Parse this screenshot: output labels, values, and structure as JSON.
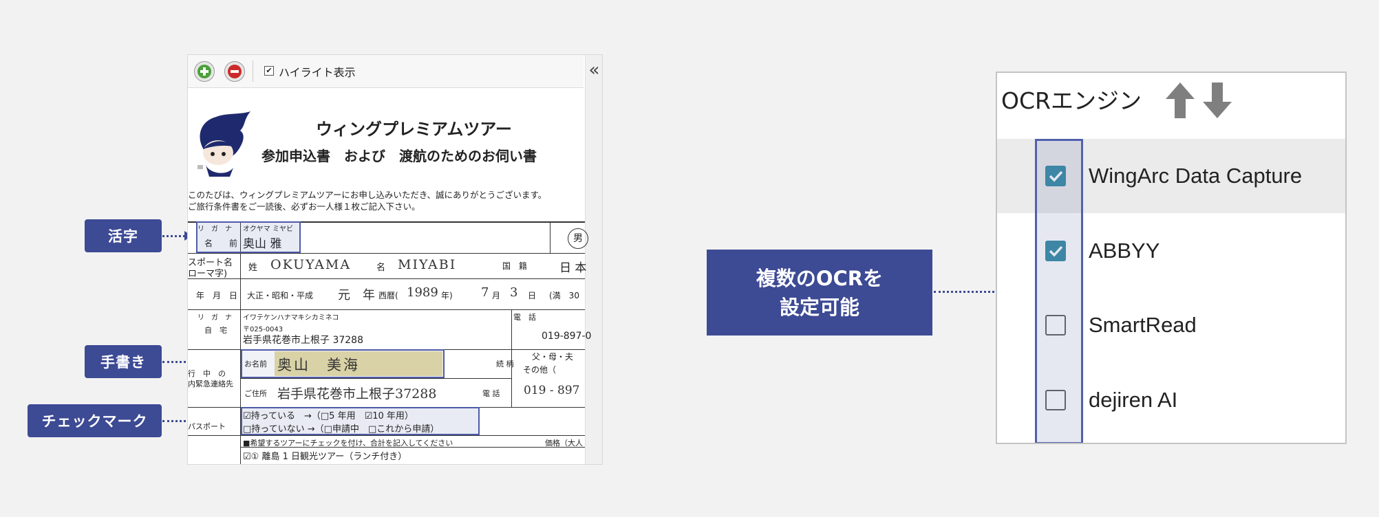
{
  "callouts": {
    "printed": "活字",
    "handwritten": "手書き",
    "checkmark": "チェックマーク",
    "multi_ocr_line1": "複数のOCRを",
    "multi_ocr_line2": "設定可能"
  },
  "viewer": {
    "highlight_label": "ハイライト表示",
    "highlight_checked": true,
    "collapse_glyph": "«",
    "zoom_in_icon": "plus-icon",
    "zoom_out_icon": "minus-icon"
  },
  "form": {
    "title": "ウィングプレミアムツアー",
    "subtitle": "参加申込書　および　渡航のためのお伺い書",
    "intro1": "このたびは、ウィングプレミアムツアーにお申し込みいただき、誠にありがとうございます。",
    "intro2": "ご旅行条件書をご一読後、必ずお一人様１枚ご記入下さい。",
    "furigana_label": "リ　ガ　ナ",
    "furigana_value": "オクヤマ ミヤビ",
    "name_label": "名　　前",
    "name_value": "奥山 雅",
    "gender": "男",
    "passport_label1": "スポート名",
    "passport_label2": "ローマ字)",
    "sei_label": "姓",
    "sei_value": "OKUYAMA",
    "mei_label": "名",
    "mei_value": "MIYABI",
    "nationality_label": "国　籍",
    "nationality_value": "日 本",
    "birth_label": "年　月　日",
    "era_options": "大正・昭和・平成",
    "era_year": "元　年",
    "seireki_label": "西暦(",
    "seireki_value": "1989",
    "seireki_suffix": "年)",
    "birth_month": "7",
    "birth_month_unit": "月",
    "birth_day": "3",
    "birth_day_unit": "日",
    "age_label": "(満　30",
    "address_furigana_label": "リ　ガ　ナ",
    "address_furigana_value": "イワテケンハナマキシカミネコ",
    "home_label": "自　宅",
    "postal": "〒025-0043",
    "address_value": "岩手県花巻市上根子 37288",
    "phone_label": "電　話",
    "phone_value": "019-897-0",
    "emergency_label1": "行　中　の",
    "emergency_label2": "内緊急連絡先",
    "emergency_name_label": "お名前",
    "emergency_name_value": "奥山　美海",
    "relation_label": "続 柄",
    "relation_value1": "父・母・夫",
    "relation_value2": "その他（",
    "emergency_address_label": "ご住所",
    "emergency_address_value": "岩手県花巻市上根子37288",
    "emergency_phone_label": "電 話",
    "emergency_phone_value": "019 - 897",
    "passport_row_label": "パスポート",
    "passport_have": "☑持っている　→（□5 年用　☑10 年用）",
    "passport_not": "□持っていない →（□申請中　□これから申請）",
    "tour_note": "■希望するツアーにチェックを付け、合計を記入してください",
    "price_label": "価格（大人",
    "tour_item": "☑①  離島 1 日観光ツアー（ランチ付き）"
  },
  "ocr_engine": {
    "title": "OCRエンジン",
    "up_icon": "arrow-up-icon",
    "down_icon": "arrow-down-icon",
    "engines": [
      {
        "name": "WingArc Data Capture",
        "checked": true,
        "selected": true
      },
      {
        "name": "ABBYY",
        "checked": true,
        "selected": false
      },
      {
        "name": "SmartRead",
        "checked": false,
        "selected": false
      },
      {
        "name": "dejiren AI",
        "checked": false,
        "selected": false
      }
    ]
  },
  "colors": {
    "accent": "#3d4a94",
    "checkbox_checked": "#3d8fa8",
    "handwriting_highlight": "#d9d2a6"
  }
}
